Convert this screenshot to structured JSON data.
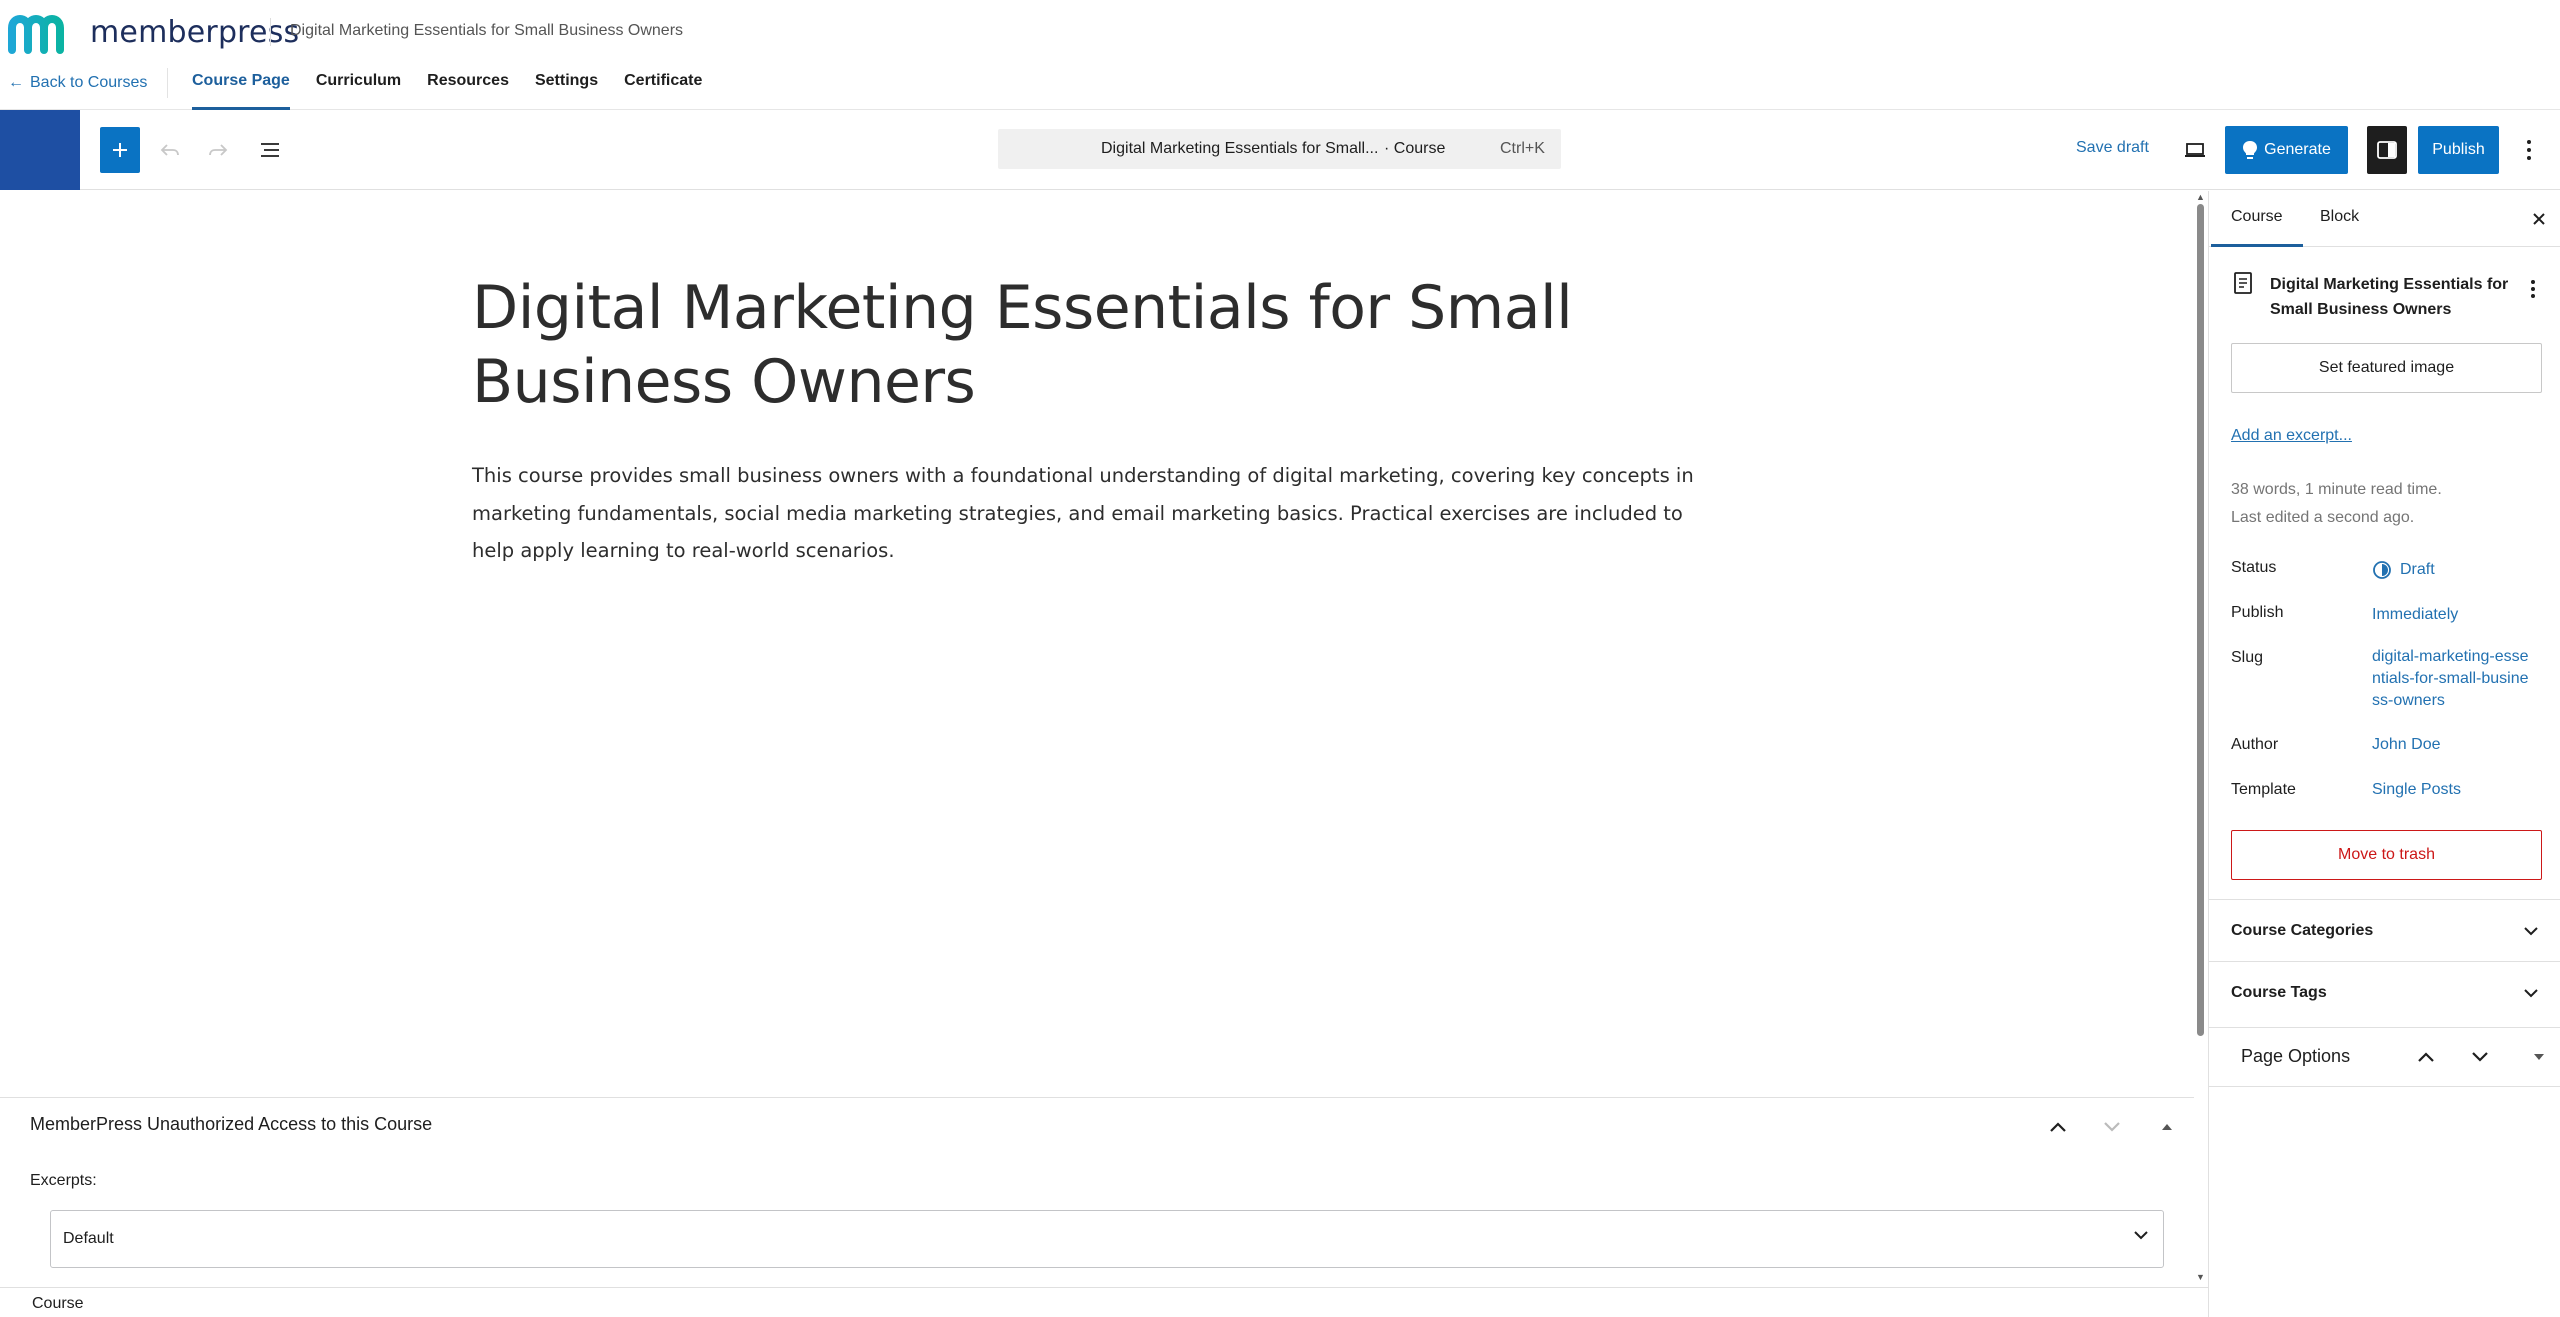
{
  "brand": {
    "logo_text": "memberpress",
    "course_title": "Digital Marketing Essentials for Small Business Owners",
    "back_label": "Back to Courses"
  },
  "nav": {
    "tabs": [
      {
        "label": "Course Page",
        "active": true
      },
      {
        "label": "Curriculum",
        "active": false
      },
      {
        "label": "Resources",
        "active": false
      },
      {
        "label": "Settings",
        "active": false
      },
      {
        "label": "Certificate",
        "active": false
      }
    ]
  },
  "toolbar": {
    "command_title": "Digital Marketing Essentials for Small...",
    "command_type": "· Course",
    "command_shortcut": "Ctrl+K",
    "save_draft": "Save draft",
    "generate": "Generate",
    "publish": "Publish"
  },
  "post": {
    "title": "Digital Marketing Essentials for Small Business Owners",
    "body": "This course provides small business owners with a foundational understanding of digital marketing, covering key concepts in marketing fundamentals, social media marketing strategies, and email marketing basics. Practical exercises are included to help apply learning to real-world scenarios."
  },
  "metabox": {
    "title": "MemberPress Unauthorized Access to this Course",
    "excerpts_label": "Excerpts:",
    "excerpts_value": "Default"
  },
  "footer": {
    "breadcrumb": "Course"
  },
  "sidebar": {
    "tabs": [
      {
        "label": "Course",
        "active": true
      },
      {
        "label": "Block",
        "active": false
      }
    ],
    "post_title": "Digital Marketing Essentials for Small Business Owners",
    "featured_image": "Set featured image",
    "add_excerpt": "Add an excerpt...",
    "word_count": "38 words, 1 minute read time.",
    "last_edited": "Last edited a second ago.",
    "rows": {
      "status": {
        "label": "Status",
        "value": "Draft"
      },
      "publish": {
        "label": "Publish",
        "value": "Immediately"
      },
      "slug": {
        "label": "Slug",
        "value": "digital-marketing-essentials-for-small-business-owners"
      },
      "author": {
        "label": "Author",
        "value": "John Doe"
      },
      "template": {
        "label": "Template",
        "value": "Single Posts"
      }
    },
    "trash": "Move to trash",
    "panels": {
      "categories": "Course Categories",
      "tags": "Course Tags",
      "page_options": "Page Options"
    }
  },
  "colors": {
    "accent": "#0a73c3",
    "link": "#2271b1",
    "danger": "#cc1818",
    "wp_block": "#1e4fa3"
  }
}
